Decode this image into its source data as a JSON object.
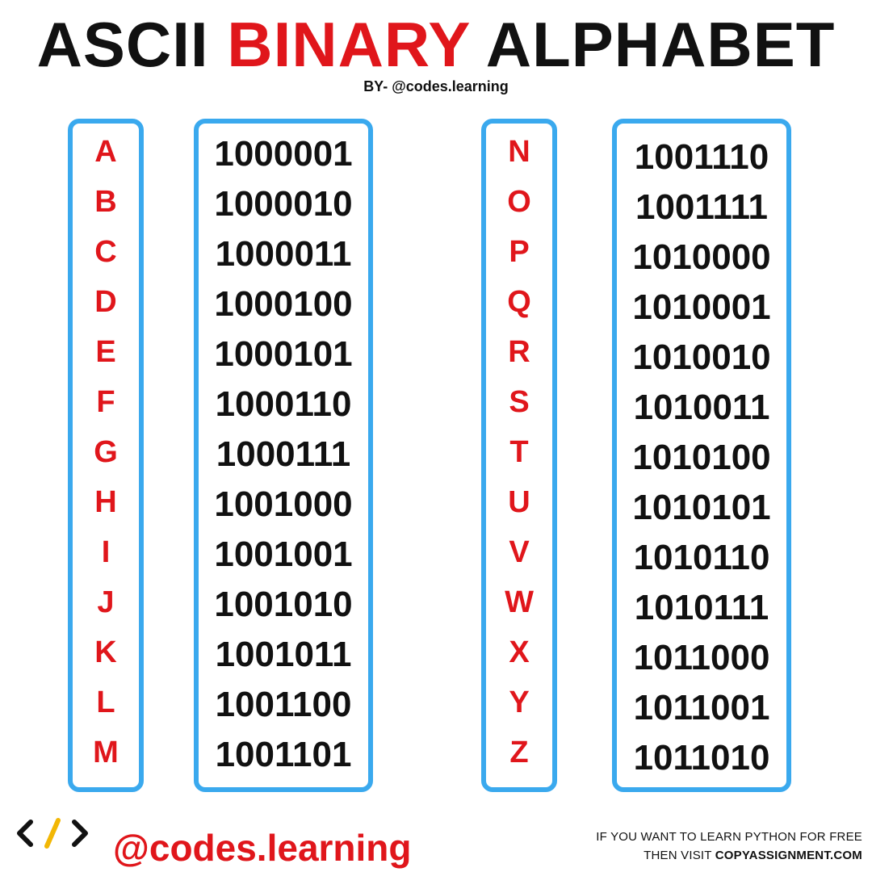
{
  "header": {
    "title_part1": "ASCII",
    "title_part2": "BINARY",
    "title_part3": "ALPHABET",
    "byline": "BY- @codes.learning"
  },
  "left_letters": [
    "A",
    "B",
    "C",
    "D",
    "E",
    "F",
    "G",
    "H",
    "I",
    "J",
    "K",
    "L",
    "M"
  ],
  "left_codes": [
    "1000001",
    "1000010",
    "1000011",
    "1000100",
    "1000101",
    "1000110",
    "1000111",
    "1001000",
    "1001001",
    "1001010",
    "1001011",
    "1001100",
    "1001101"
  ],
  "right_letters": [
    "N",
    "O",
    "P",
    "Q",
    "R",
    "S",
    "T",
    "U",
    "V",
    "W",
    "X",
    "Y",
    "Z"
  ],
  "right_codes": [
    "1001110",
    "1001111",
    "1010000",
    "1010001",
    "1010010",
    "1010011",
    "1010100",
    "1010101",
    "1010110",
    "1010111",
    "1011000",
    "1011001",
    "1011010"
  ],
  "footer": {
    "logo_icon": "code-brackets-icon",
    "handle": "@codes.learning",
    "note_line1": "IF YOU WANT TO LEARN PYTHON FOR FREE",
    "note_line2_prefix": "THEN VISIT ",
    "note_line2_site": "COPYASSIGNMENT.COM"
  },
  "colors": {
    "accent_red": "#e0161b",
    "border_blue": "#3aa9ee",
    "logo_yellow": "#f2b705"
  }
}
